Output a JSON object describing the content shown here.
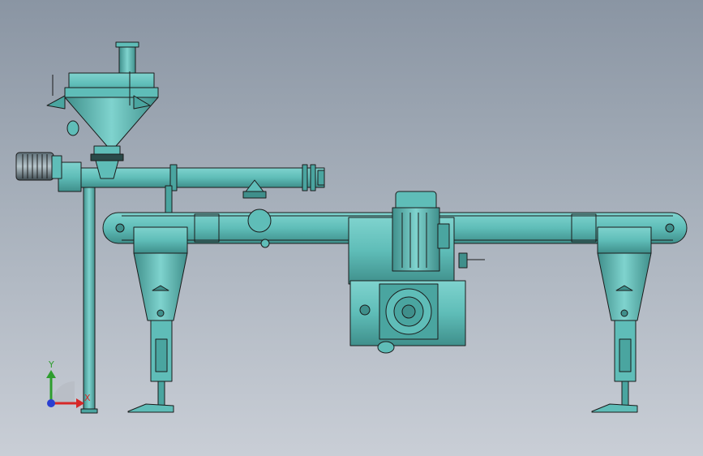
{
  "viewport": {
    "background_top": "#8a95a3",
    "background_bottom": "#c9ced6",
    "model_fill": "#5fbdb8",
    "model_fill_dark": "#3f8f8b",
    "edge_color": "#1b1b1b"
  },
  "triad": {
    "y_label": "Y",
    "x_label": "X",
    "x_color": "#d62828",
    "y_color": "#2e9d2e",
    "z_color": "#2a3fd1"
  },
  "assembly": {
    "components": [
      "motor-icon",
      "hopper-icon",
      "screw-conveyor-icon",
      "belt-conveyor-icon",
      "gear-motor-icon",
      "gearbox-icon",
      "leg-stand-icon",
      "leveling-foot-icon",
      "support-post-icon"
    ]
  }
}
